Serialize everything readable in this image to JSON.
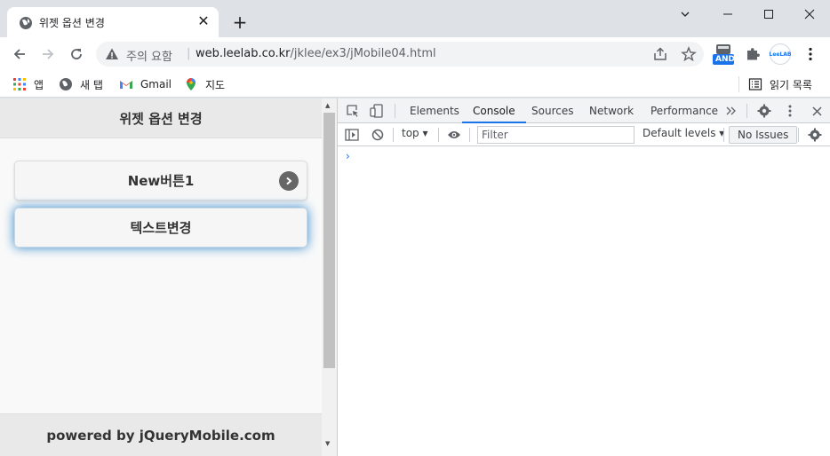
{
  "browser": {
    "tab_title": "위젯 옵션 변경",
    "url_security": "주의 요함",
    "url_host": "web.leelab.co.kr",
    "url_path": "/jklee/ex3/jMobile04.html",
    "extension_badge": "AND",
    "profile_label": "LeeLAB"
  },
  "bookmarks": {
    "apps": "앱",
    "newtab": "새 탭",
    "gmail": "Gmail",
    "maps": "지도",
    "reading_list": "읽기 목록"
  },
  "page": {
    "header_title": "위젯 옵션 변경",
    "button1_label": "New버튼1",
    "button2_label": "텍스트변경",
    "footer_text": "powered by jQueryMobile.com"
  },
  "devtools": {
    "tabs": [
      "Elements",
      "Console",
      "Sources",
      "Network",
      "Performance"
    ],
    "active_tab": "Console",
    "context": "top",
    "filter_placeholder": "Filter",
    "levels": "Default levels",
    "issues": "No Issues",
    "prompt": "›"
  },
  "colors": {
    "accent": "#1a73e8",
    "focus_glow": "#3388cc"
  }
}
